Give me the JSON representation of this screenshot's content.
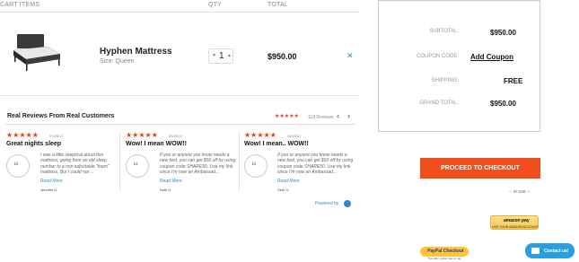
{
  "cart": {
    "headers": {
      "item": "CART ITEMS",
      "qty": "QTY",
      "total": "TOTAL"
    },
    "item": {
      "name": "Hyphen Mattress",
      "size": "Size: Queen",
      "qty": "1",
      "price": "$950.00",
      "remove_icon": "close-icon"
    }
  },
  "reviews": {
    "title": "Real Reviews From Real Customers",
    "stars": "★★★★★",
    "count": "118 Reviews",
    "powered": "Powered by",
    "items": [
      {
        "date": "07/28/17",
        "headline": "Great nights sleep",
        "body": "I was a little skeptical about this mattress, going from an old sleep number to a non adjustable \"foam\" mattress. But I could not ...",
        "more": "Read More",
        "author": "Jennifer D."
      },
      {
        "date": "06/30/17",
        "headline": "Wow! I mean WOW!!",
        "body": "If you or anyone you know needs a new bed, you can get $50 off by using coupon code SHARE50. Use my link since I'm now an Ambassad...",
        "more": "Read More",
        "author": "Seth D."
      },
      {
        "date": "06/30/17",
        "headline": "Wow! I mean.. WOW!!",
        "body": "If you or anyone you know needs a new bed, you can get $50 off by using coupon code SHARE50. Use my link since I'm now an Ambassad...",
        "more": "Read More",
        "author": "Seth D."
      }
    ]
  },
  "summary": {
    "subtotal_label": "SUBTOTAL:",
    "subtotal": "$950.00",
    "coupon_label": "COUPON CODE:",
    "coupon_link": "Add Coupon",
    "shipping_label": "SHIPPING:",
    "shipping": "FREE",
    "grand_label": "GRAND TOTAL:",
    "grand": "$950.00"
  },
  "checkout": {
    "button": "PROCEED TO CHECKOUT",
    "or_use": "-- or use --",
    "amazon": "amazon pay",
    "amazon_sub": "USE YOUR AMAZON ACCOUNT",
    "paypal": "PayPal Checkout",
    "paypal_sub": "The safer, easier way to pay",
    "contact": "Contact us!"
  },
  "colors": {
    "accent": "#f04e1d",
    "link": "#2a8ec7",
    "star": "#e8401b"
  }
}
